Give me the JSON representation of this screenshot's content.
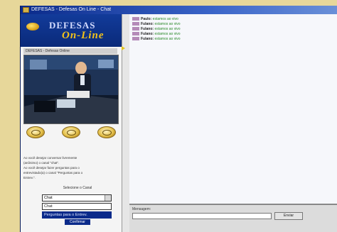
{
  "window": {
    "title": "DEFESAS - Defesas On Line - Chat"
  },
  "logo": {
    "line1": "DEFESAS",
    "line2": "On-Line"
  },
  "video": {
    "caption": "DEFESAS - Defesas Online"
  },
  "description": [
    "Ao você desejar conversar livremente",
    "(anônimo) o canal \"chat\".",
    "Ao você desejar fazer perguntas para o",
    "entrevistado(a) o canal \"Perguntas para o",
    "Entrev.\"."
  ],
  "channel": {
    "label": "Selecione o Canal",
    "selected": "Chat",
    "options": [
      "Chat",
      "Perguntas para o Entrev."
    ],
    "button": "Confirmar"
  },
  "chat": {
    "messages": [
      {
        "name": "Paulo:",
        "text": "estamos ao vivo"
      },
      {
        "name": "Fulano:",
        "text": "estamos ao vivo"
      },
      {
        "name": "Fulano:",
        "text": "estamos ao vivo"
      },
      {
        "name": "Fulano:",
        "text": "estamos ao vivo"
      },
      {
        "name": "Fulano:",
        "text": "estamos ao vivo"
      }
    ]
  },
  "input": {
    "label": "Mensagem:",
    "placeholder": "",
    "send": "Enviar"
  },
  "colors": {
    "accent": "#0a2a8a",
    "gold": "#e2c21a",
    "msg_text": "#2a8a2a"
  }
}
